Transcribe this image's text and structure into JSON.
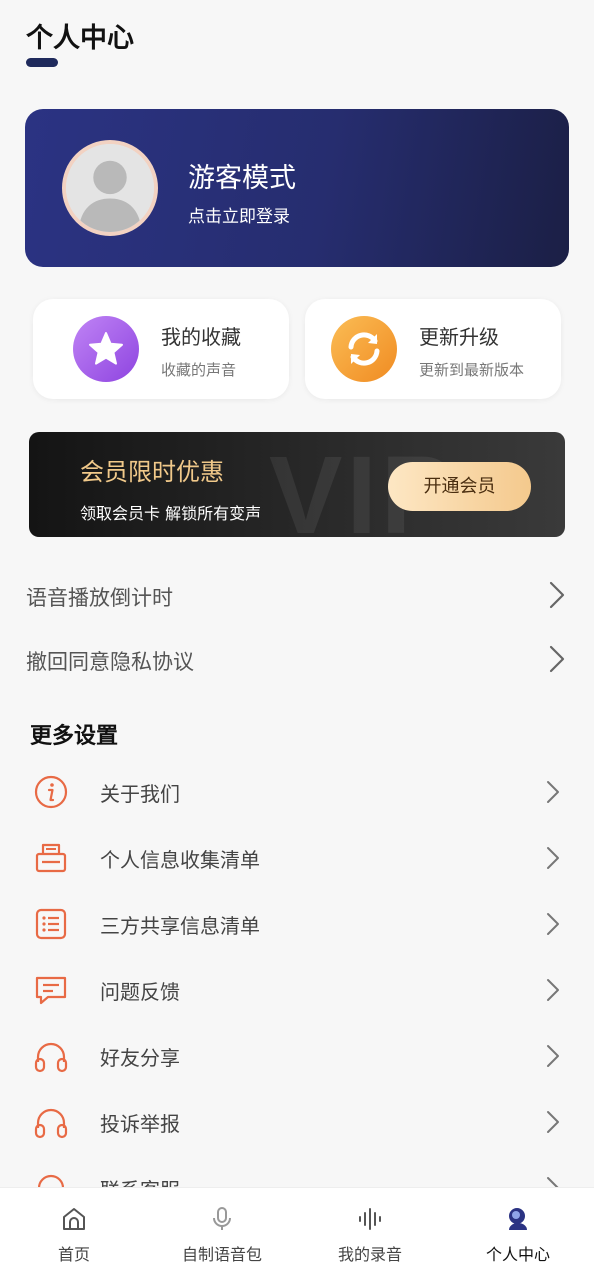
{
  "header": {
    "title": "个人中心"
  },
  "profile": {
    "name": "游客模式",
    "subtitle": "点击立即登录"
  },
  "quick_cards": [
    {
      "title": "我的收藏",
      "subtitle": "收藏的声音",
      "icon": "star-icon",
      "color": "#a15ce6"
    },
    {
      "title": "更新升级",
      "subtitle": "更新到最新版本",
      "icon": "refresh-icon",
      "color": "#f6a33a"
    }
  ],
  "vip": {
    "title": "会员限时优惠",
    "subtitle": "领取会员卡 解锁所有变声",
    "button": "开通会员",
    "watermark": "VIP"
  },
  "plain_rows": [
    {
      "label": "语音播放倒计时"
    },
    {
      "label": "撤回同意隐私协议"
    }
  ],
  "more_settings": {
    "title": "更多设置",
    "items": [
      {
        "label": "关于我们",
        "icon": "info-icon"
      },
      {
        "label": "个人信息收集清单",
        "icon": "printer-icon"
      },
      {
        "label": "三方共享信息清单",
        "icon": "list-icon"
      },
      {
        "label": "问题反馈",
        "icon": "message-icon"
      },
      {
        "label": "好友分享",
        "icon": "headphones-icon"
      },
      {
        "label": "投诉举报",
        "icon": "headphones-icon"
      },
      {
        "label": "联系客服",
        "icon": "headset-icon"
      }
    ]
  },
  "accent_color": "#e86a45",
  "nav": [
    {
      "label": "首页",
      "icon": "home-icon",
      "active": false
    },
    {
      "label": "自制语音包",
      "icon": "microphone-icon",
      "active": false
    },
    {
      "label": "我的录音",
      "icon": "waveform-icon",
      "active": false
    },
    {
      "label": "个人中心",
      "icon": "user-icon",
      "active": true
    }
  ]
}
